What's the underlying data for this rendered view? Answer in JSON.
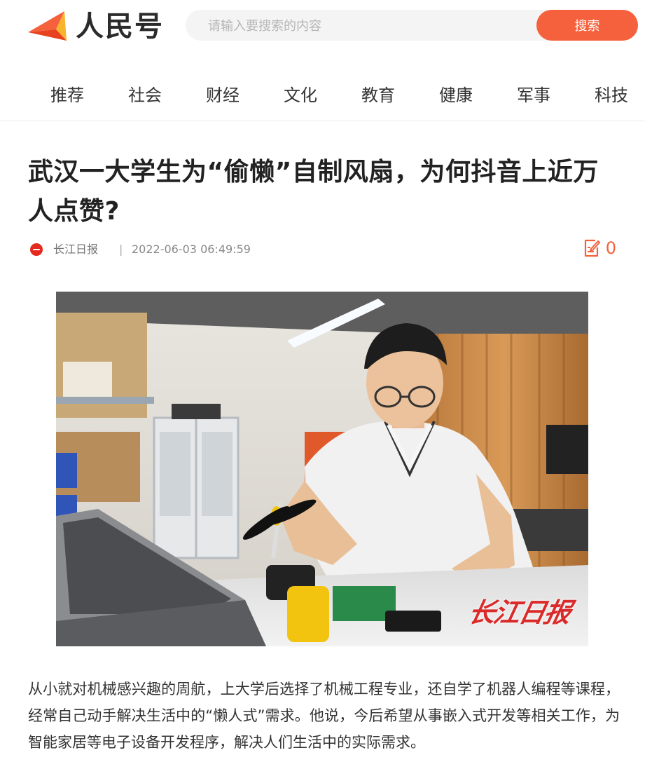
{
  "header": {
    "logo_text": "人民号",
    "search_placeholder": "请输入要搜索的内容",
    "search_button": "搜索"
  },
  "nav": {
    "items": [
      {
        "label": "推荐"
      },
      {
        "label": "社会"
      },
      {
        "label": "财经"
      },
      {
        "label": "文化"
      },
      {
        "label": "教育"
      },
      {
        "label": "健康"
      },
      {
        "label": "军事"
      },
      {
        "label": "科技"
      }
    ]
  },
  "article": {
    "title": "武汉一大学生为“偷懒”自制风扇，为何抖音上近万人点赞?",
    "source": "长江日报",
    "separator": "|",
    "date": "2022-06-03 06:49:59",
    "comment_count": "0",
    "photo_watermark": "长江日报",
    "paragraph": "从小就对机械感兴趣的周航，上大学后选择了机械工程专业，还自学了机器人编程等课程，经常自己动手解决生活中的“懒人式”需求。他说，今后希望从事嵌入式开发等相关工作，为智能家居等电子设备开发程序，解决人们生活中的实际需求。"
  },
  "icons": {
    "logo": "renminhao-logo-icon",
    "source": "source-logo-icon",
    "comment": "comment-edit-icon"
  },
  "colors": {
    "accent": "#f5613c",
    "title": "#222222",
    "meta": "#888888"
  }
}
